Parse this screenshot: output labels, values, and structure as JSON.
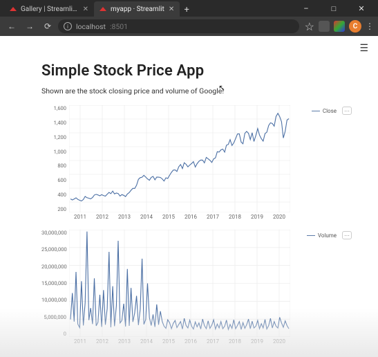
{
  "window": {
    "tabs": [
      {
        "label": "Gallery | Streamlit — The fastest"
      },
      {
        "label": "myapp · Streamlit"
      }
    ],
    "url_host": "localhost",
    "url_port": ":8501",
    "profile_initial": "C"
  },
  "page": {
    "title": "Simple Stock Price App",
    "subtitle": "Shown are the stock closing price and volume of Google!"
  },
  "legend": {
    "close": "Close",
    "volume": "Volume"
  },
  "chart_data": [
    {
      "type": "line",
      "name": "Close",
      "xlabel": "",
      "ylabel": "",
      "ylim": [
        50,
        1600
      ],
      "x_start": 2010.4,
      "x_end": 2020.4,
      "xticks": [
        2011,
        2012,
        2013,
        2014,
        2015,
        2016,
        2017,
        2018,
        2019,
        2020
      ],
      "yticks": [
        200,
        400,
        600,
        800,
        1000,
        1200,
        1400,
        1600
      ],
      "series": [
        {
          "name": "Close",
          "color": "#4b6fa4",
          "values": [
            245,
            230,
            244,
            261,
            238,
            225,
            216,
            236,
            281,
            262,
            255,
            246,
            265,
            301,
            311,
            302,
            290,
            306,
            294,
            285,
            313,
            339,
            321,
            358,
            317,
            330,
            323,
            287,
            307,
            297,
            279,
            316,
            337,
            370,
            398,
            396,
            442,
            528,
            552,
            559,
            586,
            560,
            534,
            514,
            556,
            570,
            521,
            561,
            559,
            555,
            534,
            503,
            550,
            541,
            586,
            629,
            661,
            664,
            642,
            710,
            742,
            684,
            768,
            745,
            708,
            735,
            757,
            784,
            706,
            754,
            788,
            807,
            806,
            766,
            845,
            824,
            803,
            772,
            822,
            839,
            927,
            922,
            954,
            965,
            921,
            1021,
            1033,
            1102,
            1017,
            1055,
            1118,
            1183,
            1185,
            1066,
            1042,
            1193,
            1221,
            1193,
            1103,
            1202,
            1075,
            1162,
            1262,
            1168,
            1116,
            1080,
            1189,
            1209,
            1307,
            1345,
            1335,
            1296,
            1435,
            1482,
            1435,
            1360,
            1125,
            1224,
            1385,
            1405
          ]
        }
      ]
    },
    {
      "type": "line",
      "name": "Volume",
      "xlabel": "",
      "ylabel": "",
      "ylim": [
        0,
        30000000
      ],
      "x_start": 2010.4,
      "x_end": 2020.4,
      "xticks": [
        2011,
        2012,
        2013,
        2014,
        2015,
        2016,
        2017,
        2018,
        2019,
        2020
      ],
      "yticks": [
        0,
        5000000,
        10000000,
        15000000,
        20000000,
        25000000,
        30000000
      ],
      "series": [
        {
          "name": "Volume",
          "color": "#4b6fa4",
          "values": [
            4900000,
            12300000,
            4300000,
            18200000,
            3600000,
            2600000,
            15600000,
            3200000,
            9500000,
            29500000,
            4700000,
            8100000,
            3600000,
            16400000,
            3100000,
            4100000,
            11800000,
            2800000,
            13100000,
            3400000,
            7900000,
            23800000,
            2700000,
            14200000,
            3000000,
            8700000,
            26900000,
            3900000,
            4600000,
            9300000,
            2900000,
            19000000,
            3100000,
            13700000,
            4200000,
            6700000,
            11500000,
            3300000,
            7700000,
            21900000,
            3500000,
            4900000,
            15000000,
            5400000,
            3200000,
            6300000,
            2800000,
            9100000,
            3400000,
            7200000,
            4300000,
            3000000,
            2400000,
            4800000,
            4000000,
            2300000,
            3800000,
            4600000,
            2600000,
            3500000,
            4300000,
            2200000,
            5200000,
            3200000,
            2500000,
            4700000,
            3000000,
            2200000,
            4200000,
            2800000,
            3900000,
            2200000,
            5000000,
            3200000,
            2300000,
            4500000,
            2400000,
            3300000,
            4800000,
            2200000,
            3600000,
            2500000,
            4300000,
            2300000,
            3000000,
            4700000,
            2100000,
            3500000,
            2400000,
            4800000,
            2300000,
            3200000,
            4300000,
            2100000,
            4000000,
            2400000,
            3400000,
            5000000,
            2300000,
            4400000,
            2500000,
            3000000,
            4600000,
            2300000,
            3700000,
            2500000,
            4900000,
            2200000,
            3200000,
            5200000,
            2500000,
            4300000,
            3000000,
            2500000,
            5500000,
            3900000,
            2700000,
            4500000,
            3200000,
            2300000
          ]
        }
      ]
    }
  ]
}
